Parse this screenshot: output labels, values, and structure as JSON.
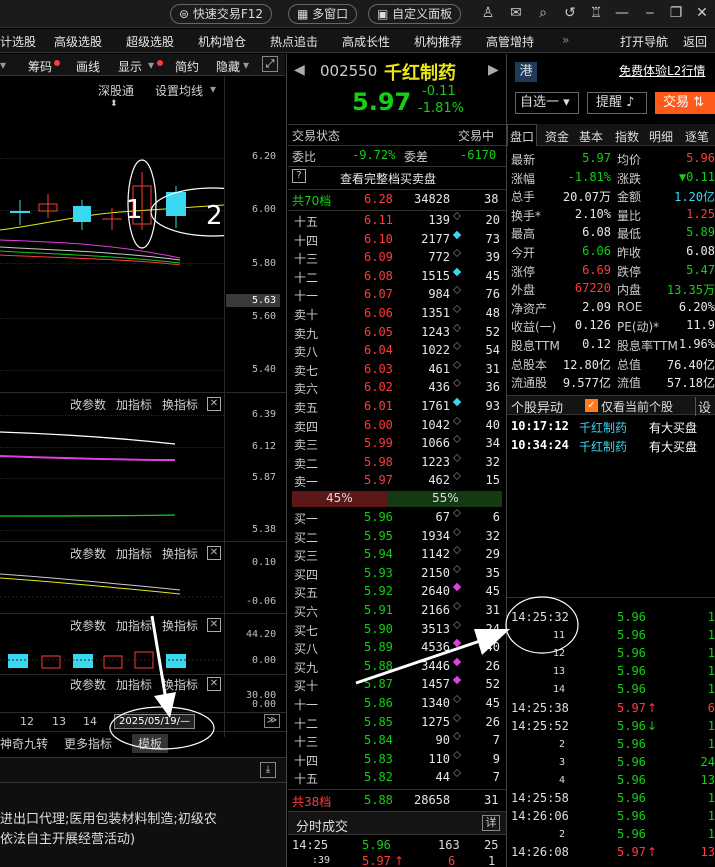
{
  "titlebar": {
    "buttons": [
      "快速交易F12",
      "多窗口",
      "自定义面板"
    ]
  },
  "menu": [
    "计选股",
    "高级选股",
    "超级选股",
    "机构增仓",
    "热点追击",
    "高成长性",
    "机构推荐",
    "高管增持",
    "打开导航",
    "返回"
  ],
  "chart_toolbar": [
    "筹码",
    "画线",
    "显示",
    "简约",
    "隐藏"
  ],
  "chart_head": {
    "tab1": "深股通",
    "tab2": "设置均线"
  },
  "price_axis": [
    "6.20",
    "6.00",
    "5.80",
    "5.63",
    "5.60",
    "5.40"
  ],
  "annot": {
    "one": "1",
    "two": "2"
  },
  "panel2": {
    "btn1": "改参数",
    "btn2": "加指标",
    "btn3": "换指标",
    "axis": [
      "6.39",
      "6.12",
      "5.87",
      "5.38"
    ]
  },
  "panel3": {
    "btn1": "改参数",
    "btn2": "加指标",
    "btn3": "换指标",
    "axis": [
      "0.10",
      "-0.06"
    ]
  },
  "panel4": {
    "btn1": "改参数",
    "btn2": "加指标",
    "btn3": "换指标",
    "axis": [
      "44.20",
      "0.00"
    ]
  },
  "panel5": {
    "btn1": "改参数",
    "btn2": "加指标",
    "btn3": "换指标",
    "axis": [
      "30.00",
      "0.00"
    ]
  },
  "dates": {
    "d1": "12",
    "d2": "13",
    "d3": "14",
    "sel": "2025/05/19/—"
  },
  "bottom_tabs": {
    "t1": "神奇九转",
    "t2": "更多指标",
    "t3": "模板"
  },
  "company": {
    "l1": "进出口代理;医用包装材料制造;初级农",
    "l2": "依法自主开展经营活动)"
  },
  "stock": {
    "code": "002550",
    "name": "千红制药",
    "tag": "港",
    "price": "5.97",
    "change": "-0.11",
    "pct": "-1.81%",
    "promo": "免费体验L2行情",
    "btn_watch": "自选一",
    "btn_alert": "提醒",
    "btn_trade": "交易"
  },
  "status": {
    "label": "交易状态",
    "value": "交易中"
  },
  "ratio": {
    "l1": "委比",
    "v1": "-9.72%",
    "l2": "委差",
    "v2": "-6170"
  },
  "full_book": "查看完整档买卖盘",
  "sell_total": {
    "label": "共70档",
    "price": "6.28",
    "vol": "34828",
    "n": "38"
  },
  "sells": [
    {
      "l": "十五",
      "p": "6.11",
      "v": "139",
      "n": "20",
      "d": ""
    },
    {
      "l": "十四",
      "p": "6.10",
      "v": "2177",
      "n": "73",
      "d": "c"
    },
    {
      "l": "十三",
      "p": "6.09",
      "v": "772",
      "n": "39",
      "d": ""
    },
    {
      "l": "十二",
      "p": "6.08",
      "v": "1515",
      "n": "45",
      "d": "c"
    },
    {
      "l": "十一",
      "p": "6.07",
      "v": "984",
      "n": "76",
      "d": ""
    },
    {
      "l": "卖十",
      "p": "6.06",
      "v": "1351",
      "n": "48",
      "d": ""
    },
    {
      "l": "卖九",
      "p": "6.05",
      "v": "1243",
      "n": "52",
      "d": ""
    },
    {
      "l": "卖八",
      "p": "6.04",
      "v": "1022",
      "n": "54",
      "d": ""
    },
    {
      "l": "卖七",
      "p": "6.03",
      "v": "461",
      "n": "31",
      "d": ""
    },
    {
      "l": "卖六",
      "p": "6.02",
      "v": "436",
      "n": "36",
      "d": ""
    },
    {
      "l": "卖五",
      "p": "6.01",
      "v": "1761",
      "n": "93",
      "d": "c"
    },
    {
      "l": "卖四",
      "p": "6.00",
      "v": "1042",
      "n": "40",
      "d": ""
    },
    {
      "l": "卖三",
      "p": "5.99",
      "v": "1066",
      "n": "34",
      "d": ""
    },
    {
      "l": "卖二",
      "p": "5.98",
      "v": "1223",
      "n": "32",
      "d": ""
    },
    {
      "l": "卖一",
      "p": "5.97",
      "v": "462",
      "n": "15",
      "d": ""
    }
  ],
  "bar_pct": {
    "left": "45%",
    "right": "55%"
  },
  "buys": [
    {
      "l": "买一",
      "p": "5.96",
      "v": "67",
      "n": "6",
      "d": ""
    },
    {
      "l": "买二",
      "p": "5.95",
      "v": "1934",
      "n": "32",
      "d": ""
    },
    {
      "l": "买三",
      "p": "5.94",
      "v": "1142",
      "n": "29",
      "d": ""
    },
    {
      "l": "买四",
      "p": "5.93",
      "v": "2150",
      "n": "35",
      "d": ""
    },
    {
      "l": "买五",
      "p": "5.92",
      "v": "2640",
      "n": "45",
      "d": "m"
    },
    {
      "l": "买六",
      "p": "5.91",
      "v": "2166",
      "n": "31",
      "d": ""
    },
    {
      "l": "买七",
      "p": "5.90",
      "v": "3513",
      "n": "24",
      "d": ""
    },
    {
      "l": "买八",
      "p": "5.89",
      "v": "4536",
      "n": "40",
      "d": "m"
    },
    {
      "l": "买九",
      "p": "5.88",
      "v": "3446",
      "n": "26",
      "d": "m"
    },
    {
      "l": "买十",
      "p": "5.87",
      "v": "1457",
      "n": "52",
      "d": "m"
    },
    {
      "l": "十一",
      "p": "5.86",
      "v": "1340",
      "n": "45",
      "d": ""
    },
    {
      "l": "十二",
      "p": "5.85",
      "v": "1275",
      "n": "26",
      "d": ""
    },
    {
      "l": "十三",
      "p": "5.84",
      "v": "90",
      "n": "7",
      "d": ""
    },
    {
      "l": "十四",
      "p": "5.83",
      "v": "110",
      "n": "9",
      "d": ""
    },
    {
      "l": "十五",
      "p": "5.82",
      "v": "44",
      "n": "7",
      "d": ""
    }
  ],
  "buy_total": {
    "label": "共38档",
    "price": "5.88",
    "vol": "28658",
    "n": "31"
  },
  "ticks_tab": {
    "label": "分时成交",
    "btn": "详"
  },
  "tick_rows": [
    {
      "t": "14:25",
      "p": "5.96",
      "v": "163",
      "n": "25"
    },
    {
      "t": ":39",
      "p": "5.97",
      "v": "6",
      "n": "1"
    }
  ],
  "quote_tabs": [
    "盘口",
    "资金",
    "基本",
    "指数",
    "明细",
    "逐笔"
  ],
  "quote": [
    {
      "l1": "最新",
      "v1": "5.97",
      "l2": "均价",
      "v2": "5.96",
      "c1": "c-green",
      "c2": "c-red"
    },
    {
      "l1": "涨幅",
      "v1": "-1.81%",
      "l2": "涨跌",
      "v2": "▼0.11",
      "c1": "c-green",
      "c2": "c-green"
    },
    {
      "l1": "总手",
      "v1": "20.07万",
      "l2": "金额",
      "v2": "1.20亿",
      "c1": "c-wh",
      "c2": "c-cy"
    },
    {
      "l1": "换手*",
      "v1": "2.10%",
      "l2": "量比",
      "v2": "1.25",
      "c1": "c-wh",
      "c2": "c-red"
    },
    {
      "l1": "最高",
      "v1": "6.08",
      "l2": "最低",
      "v2": "5.89",
      "c1": "c-wh",
      "c2": "c-green"
    },
    {
      "l1": "今开",
      "v1": "6.06",
      "l2": "昨收",
      "v2": "6.08",
      "c1": "c-green",
      "c2": "c-wh"
    },
    {
      "l1": "涨停",
      "v1": "6.69",
      "l2": "跌停",
      "v2": "5.47",
      "c1": "c-red",
      "c2": "c-green"
    },
    {
      "l1": "外盘",
      "v1": "67220",
      "l2": "内盘",
      "v2": "13.35万",
      "c1": "c-red",
      "c2": "c-green"
    },
    {
      "l1": "净资产",
      "v1": "2.09",
      "l2": "ROE",
      "v2": "6.20%",
      "c1": "c-wh",
      "c2": "c-wh"
    },
    {
      "l1": "收益(一)",
      "v1": "0.126",
      "l2": "PE(动)*",
      "v2": "11.9",
      "c1": "c-wh",
      "c2": "c-wh"
    },
    {
      "l1": "股息TTM",
      "v1": "0.12",
      "l2": "股息率TTM",
      "v2": "1.96%",
      "c1": "c-wh",
      "c2": "c-wh"
    },
    {
      "l1": "总股本",
      "v1": "12.80亿",
      "l2": "总值",
      "v2": "76.40亿",
      "c1": "c-wh",
      "c2": "c-wh"
    },
    {
      "l1": "流通股",
      "v1": "9.577亿",
      "l2": "流值",
      "v2": "57.18亿",
      "c1": "c-wh",
      "c2": "c-wh"
    }
  ],
  "anomaly": {
    "title": "个股异动",
    "chk": "仅看当前个股",
    "btn": "设"
  },
  "alerts": [
    {
      "t": "10:17:12",
      "n": "千红制药",
      "e": "有大买盘"
    },
    {
      "t": "10:34:24",
      "n": "千红制药",
      "e": "有大买盘"
    }
  ],
  "trades": [
    {
      "t": "14:25:32",
      "p": "5.96",
      "v": "1",
      "a": ""
    },
    {
      "t": "11",
      "p": "5.96",
      "v": "1",
      "a": ""
    },
    {
      "t": "12",
      "p": "5.96",
      "v": "1",
      "a": ""
    },
    {
      "t": "13",
      "p": "5.96",
      "v": "1",
      "a": ""
    },
    {
      "t": "14",
      "p": "5.96",
      "v": "1",
      "a": ""
    },
    {
      "t": "14:25:38",
      "p": "5.97",
      "v": "6",
      "a": "up"
    },
    {
      "t": "14:25:52",
      "p": "5.96",
      "v": "1",
      "a": "dn"
    },
    {
      "t": "2",
      "p": "5.96",
      "v": "1",
      "a": ""
    },
    {
      "t": "3",
      "p": "5.96",
      "v": "24",
      "a": ""
    },
    {
      "t": "4",
      "p": "5.96",
      "v": "13",
      "a": ""
    },
    {
      "t": "14:25:58",
      "p": "5.96",
      "v": "1",
      "a": ""
    },
    {
      "t": "14:26:06",
      "p": "5.96",
      "v": "1",
      "a": ""
    },
    {
      "t": "2",
      "p": "5.96",
      "v": "1",
      "a": ""
    },
    {
      "t": "14:26:08",
      "p": "5.97",
      "v": "13",
      "a": "up"
    }
  ]
}
